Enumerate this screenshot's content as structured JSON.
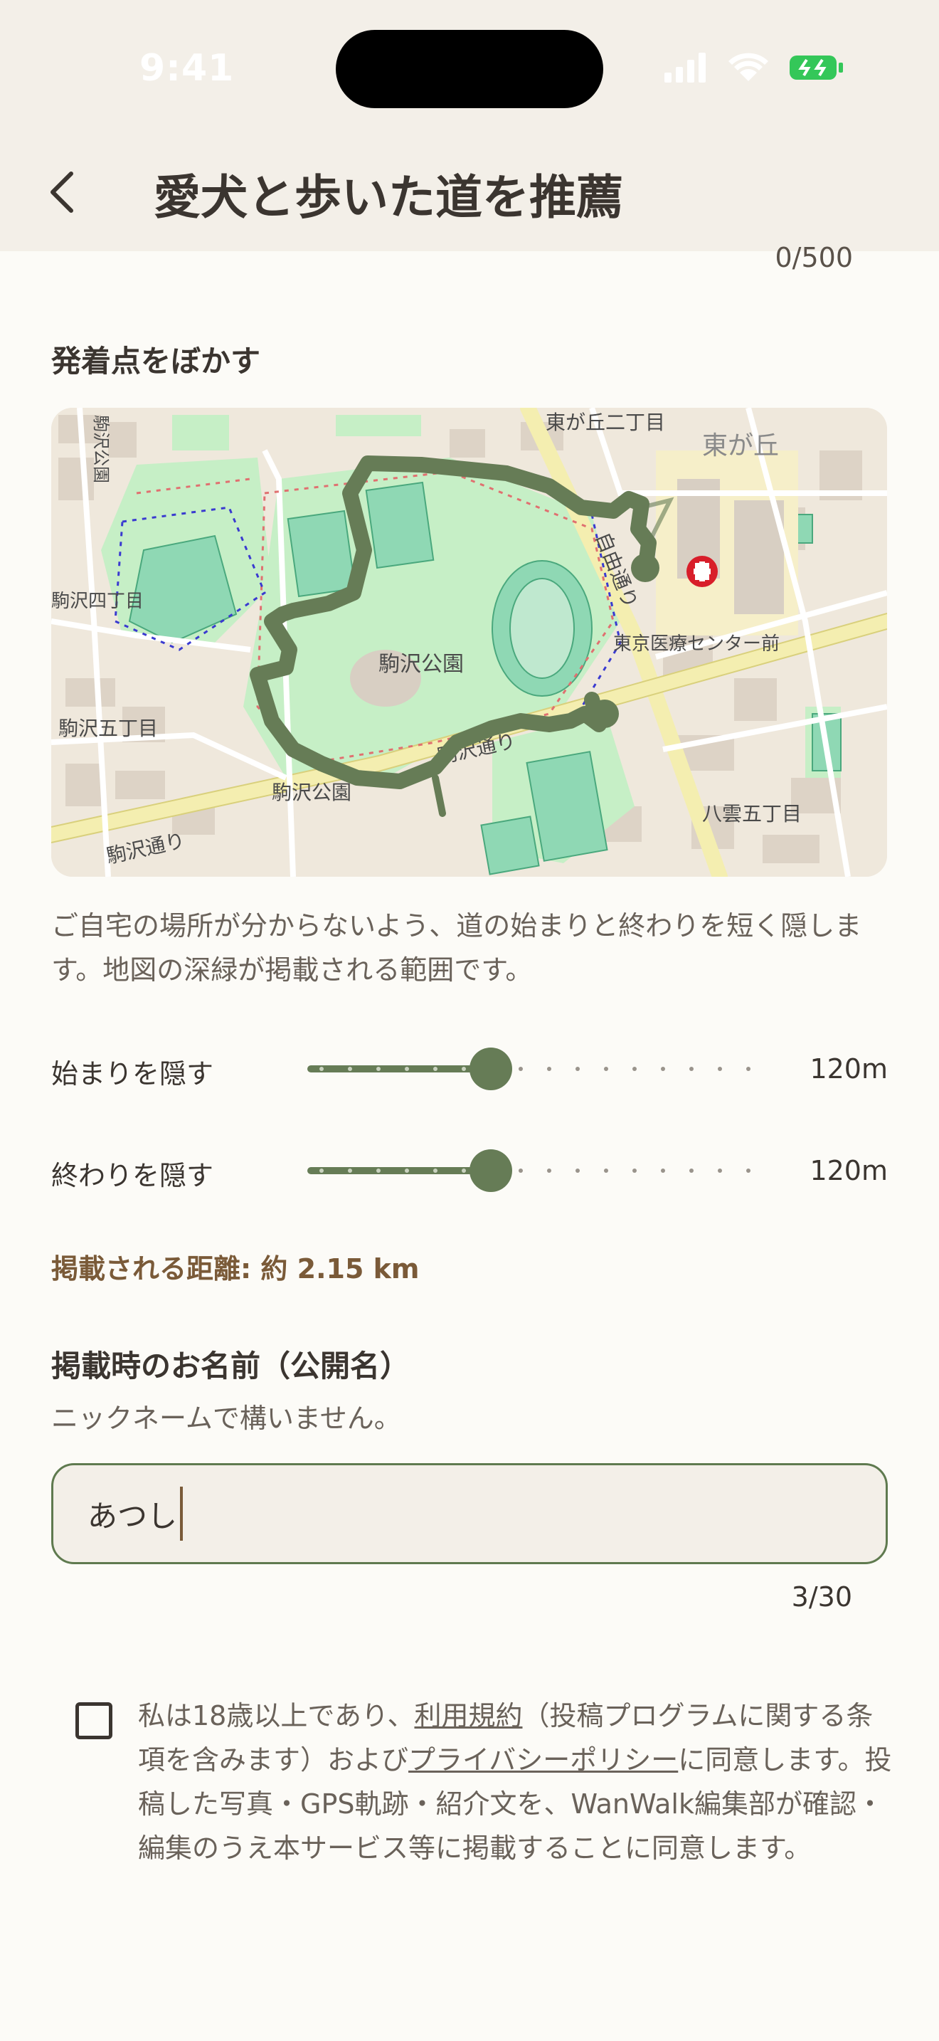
{
  "status_bar": {
    "time": "9:41"
  },
  "header": {
    "title": "愛犬と歩いた道を推薦"
  },
  "top_char_count": "0/500",
  "blur_section": {
    "label": "発着点をぼかす",
    "help_text": "ご自宅の場所が分からないよう、道の始まりと終わりを短く隠します。地図の深緑が掲載される範囲です。",
    "map_labels": {
      "higashigaoka_nichome": "東が丘二丁目",
      "higashigaoka": "東が丘",
      "jiyu_dori": "自由通り",
      "medical_center": "東京医療センター前",
      "komazawa_park": "駒沢公園",
      "komazawa_dori": "駒沢通り",
      "komazawa_park_2": "駒沢公園",
      "komazawa_4": "駒沢四丁目",
      "komazawa_5": "駒沢五丁目",
      "komazawa_dori_2": "駒沢通り",
      "yakumo_5": "八雲五丁目",
      "komazawa_park_3": "駒沢公園"
    }
  },
  "sliders": [
    {
      "label": "始まりを隠す",
      "value": "120m",
      "fraction": 0.38
    },
    {
      "label": "終わりを隠す",
      "value": "120m",
      "fraction": 0.38
    }
  ],
  "distance_text": "掲載される距離: 約 2.15 km",
  "name_section": {
    "label": "掲載時のお名前（公開名）",
    "subtext": "ニックネームで構いません。",
    "input_value": "あつし",
    "char_count": "3/30"
  },
  "consent": {
    "part1": "私は18歳以上であり、",
    "terms_link": "利用規約",
    "part2": "（投稿プログラムに関する条項を含みます）および",
    "privacy_link": "プライバシーポリシー",
    "part3": "に同意します。投稿した写真・GPS軌跡・紹介文を、WanWalk編集部が確認・編集のうえ本サービス等に掲載することに同意します。",
    "checked": false
  },
  "colors": {
    "accent": "#5f7a4f",
    "route": "#667c56",
    "header_bg": "#f3efe8",
    "background": "#fcfbf7",
    "distance_text": "#7a5a38"
  }
}
